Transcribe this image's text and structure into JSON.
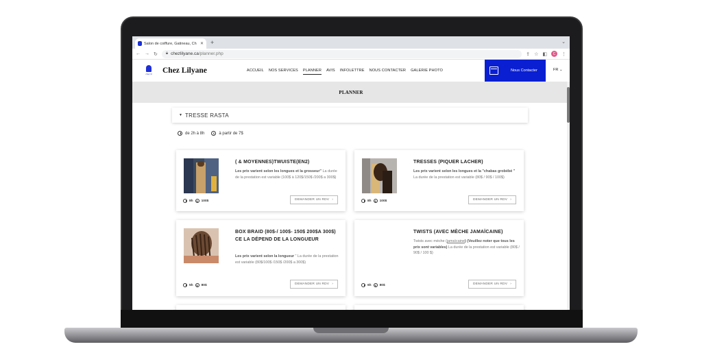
{
  "browser": {
    "tab_title": "Salon de coiffure, Gatineau, Ch",
    "tab_close": "✕",
    "new_tab": "+",
    "url_domain": "chezlilyane.ca",
    "url_path": "/planner.php",
    "avatar_letter": "C"
  },
  "header": {
    "brand": "Chez Lilyane",
    "logo_text": "chez lil",
    "menu": [
      "ACCUEIL",
      "NOS SERVICES",
      "PLANNER",
      "AVIS",
      "INFOLETTRE",
      "NOUS CONTACTER",
      "GALERIE PHOTO"
    ],
    "active_menu": "PLANNER",
    "contact_label": "Nous Contacter",
    "lang": "FR ⌄"
  },
  "page_title": "PLANNER",
  "category": {
    "label": "TRESSE RASTA",
    "duration": "de 2h à 8h",
    "price": "à partir de 7$"
  },
  "services": [
    {
      "title": "( & MOYENNES)TWUISTE(EN2)",
      "desc_bold": "Les prix varient selon les longues et la grosseur\"",
      "desc_rest": " La durée de la prestation est variable (100$ à 120$/150$ /200$ a 300$)",
      "duration": "8h",
      "price": "100$",
      "button": "DEMANDER UN RDV"
    },
    {
      "title": "TRESSES (PIQUER LACHER)",
      "desc_bold": "Les prix varient selon les longues et la \"chabas grobébé \"",
      "desc_rest": " La durée de la prestation est variable (80$ / 90$ / 100$)",
      "duration": "8h",
      "price": "100$",
      "button": "DEMANDER UN RDV"
    },
    {
      "title": "BOX BRAID (80$-/ 100$- 150$ 200$A 300$) CE LA DÉPEND DE LA LONGUEUR",
      "desc_bold": "Les prix varient selon la longueur",
      "desc_rest": " \" La durée de la prestation est variable (80$/100$ /150$ /200$ a 300$)",
      "duration": "5h",
      "price": "80$",
      "button": "DEMANDER UN RDV"
    },
    {
      "title": "TWISTS (AVEC MÈCHE JAMAÏCAINE)",
      "desc_pre": "Twists avec mèche (",
      "desc_link": "jamaïcaine",
      "desc_bold": ") (Veuillez noter que tous les prix sont variables)",
      "desc_rest": " La durée de la prestation est variable (80$ / 90$ / 100 $)",
      "duration": "6h",
      "price": "80$",
      "button": "DEMANDER UN RDV"
    }
  ],
  "colors": {
    "brand_blue": "#0a1fd1",
    "page_bar": "#e6e6e6"
  }
}
